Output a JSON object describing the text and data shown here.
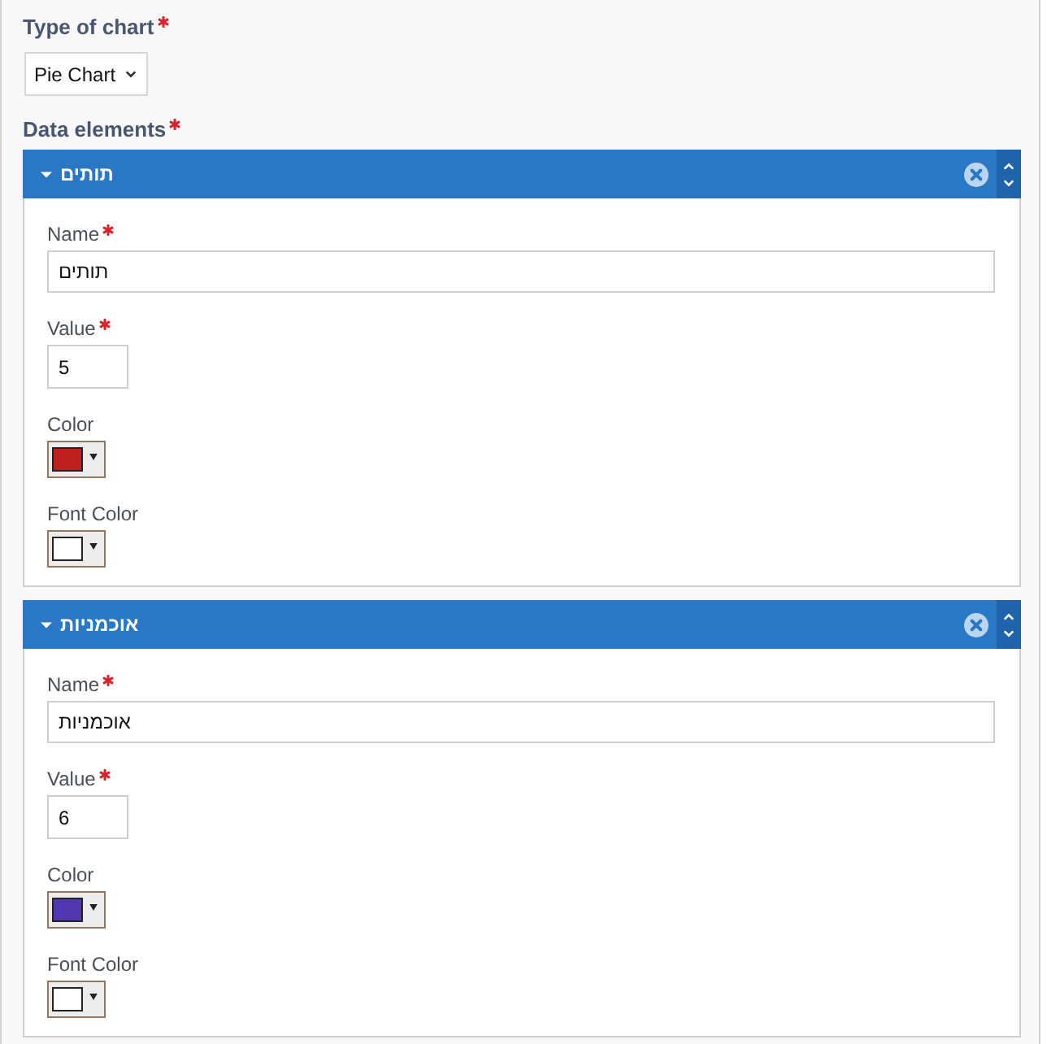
{
  "chart_type": {
    "label": "Type of chart",
    "required": true,
    "value": "Pie Chart"
  },
  "data_elements": {
    "label": "Data elements",
    "required": true,
    "items": [
      {
        "title": "תותים",
        "expanded": true,
        "fields": [
          {
            "kind": "text",
            "label": "Name",
            "required": true,
            "value": "תותים"
          },
          {
            "kind": "number",
            "label": "Value",
            "required": true,
            "value": "5"
          },
          {
            "kind": "color",
            "label": "Color",
            "required": false,
            "color": "#c0201f"
          },
          {
            "kind": "color",
            "label": "Font Color",
            "required": false,
            "color": "#ffffff"
          }
        ]
      },
      {
        "title": "אוכמניות",
        "expanded": true,
        "fields": [
          {
            "kind": "text",
            "label": "Name",
            "required": true,
            "value": "אוכמניות"
          },
          {
            "kind": "number",
            "label": "Value",
            "required": true,
            "value": "6"
          },
          {
            "kind": "color",
            "label": "Color",
            "required": false,
            "color": "#5138b0"
          },
          {
            "kind": "color",
            "label": "Font Color",
            "required": false,
            "color": "#ffffff"
          }
        ]
      }
    ]
  }
}
